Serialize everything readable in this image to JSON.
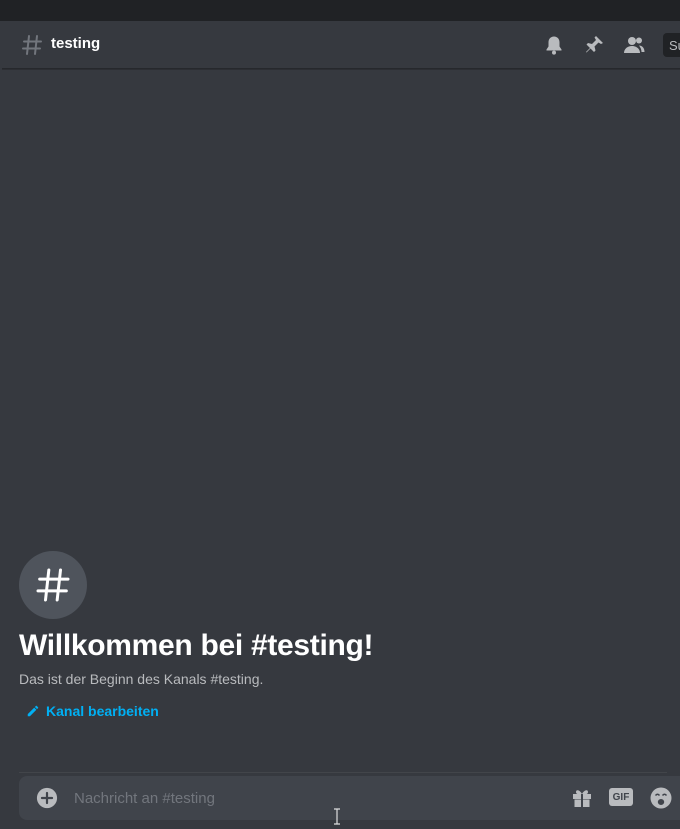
{
  "channel": {
    "name": "testing"
  },
  "header": {
    "search_text": "Su"
  },
  "welcome": {
    "title": "Willkommen bei #testing!",
    "subtitle": "Das ist der Beginn des Kanals #testing.",
    "edit_label": "Kanal bearbeiten"
  },
  "composer": {
    "placeholder": "Nachricht an #testing",
    "gif_label": "GIF"
  },
  "icons": {
    "header": [
      "hash-icon",
      "bell-icon",
      "pin-icon",
      "members-icon"
    ],
    "composer": [
      "plus-circle-icon",
      "gift-icon",
      "gif-icon",
      "emoji-icon"
    ]
  },
  "colors": {
    "background": "#36393f",
    "titlebar": "#202225",
    "link": "#00b0f4",
    "composer": "#40444b"
  }
}
